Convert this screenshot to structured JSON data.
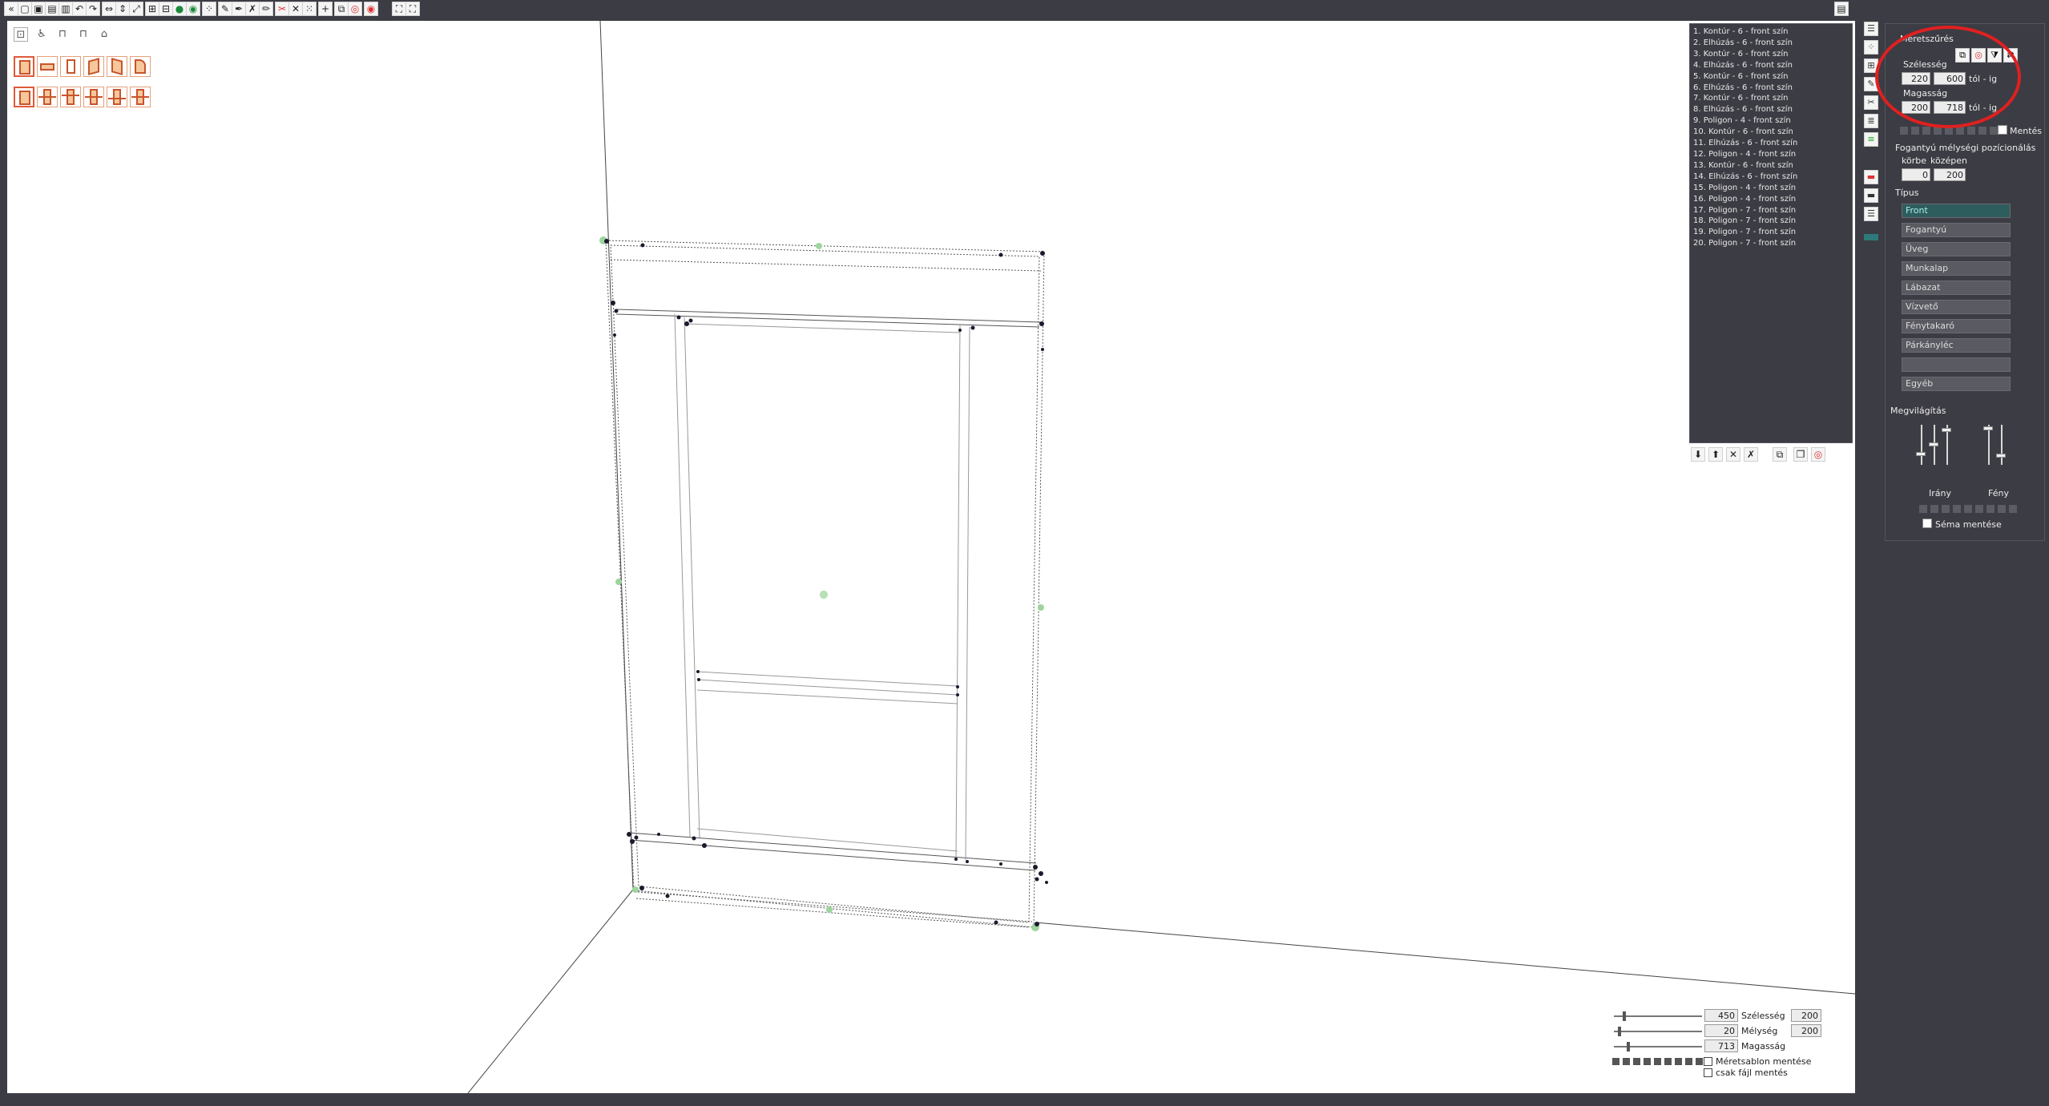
{
  "toolbar": {
    "buttons": [
      {
        "name": "back-icon",
        "glyph": "«"
      },
      {
        "name": "new-file-icon",
        "glyph": "▢"
      },
      {
        "name": "open-icon",
        "glyph": "▣"
      },
      {
        "name": "save-icon",
        "glyph": "▤"
      },
      {
        "name": "save-as-icon",
        "glyph": "▥"
      },
      {
        "name": "undo-icon",
        "glyph": "↶"
      },
      {
        "name": "redo-icon",
        "glyph": "↷"
      },
      {
        "name": "stretch-horizontal-icon",
        "glyph": "⇔"
      },
      {
        "name": "stretch-vertical-icon",
        "glyph": "⇕"
      },
      {
        "name": "stretch-diagonal-icon",
        "glyph": "⤢"
      },
      {
        "name": "snap-grid-icon",
        "glyph": "⊞"
      },
      {
        "name": "snap-edge-icon",
        "glyph": "⊟"
      },
      {
        "name": "point-add-icon",
        "glyph": "●"
      },
      {
        "name": "point-move-icon",
        "glyph": "◉"
      },
      {
        "name": "points-icon",
        "glyph": "⁘"
      },
      {
        "name": "edit-icon",
        "glyph": "✎"
      },
      {
        "name": "pen-icon",
        "glyph": "✒"
      },
      {
        "name": "cross-edit-icon",
        "glyph": "✗"
      },
      {
        "name": "brush-icon",
        "glyph": "✏"
      },
      {
        "name": "cut-icon",
        "glyph": "✂"
      },
      {
        "name": "delete-points-icon",
        "glyph": "✕"
      },
      {
        "name": "grid-points-icon",
        "glyph": "⁙"
      },
      {
        "name": "add-icon",
        "glyph": "+"
      },
      {
        "name": "copy-icon",
        "glyph": "⧉"
      },
      {
        "name": "target-icon",
        "glyph": "◎"
      },
      {
        "name": "render-icon",
        "glyph": "◉"
      },
      {
        "name": "fit-view-icon",
        "glyph": "⛶"
      },
      {
        "name": "zoom-extent-icon",
        "glyph": "⛶"
      }
    ],
    "menu_glyph": "▤"
  },
  "viewport": {
    "view_icons": [
      "door-icon",
      "chair-icon",
      "table-icon",
      "stool-icon",
      "bin-icon"
    ],
    "shape_row1": [
      "front-tall",
      "front-wide",
      "front-narrow",
      "front-skew-left",
      "front-skew-right",
      "front-corner"
    ],
    "shape_row2": [
      "split-none",
      "split-1",
      "split-2",
      "split-3",
      "split-4",
      "split-5"
    ]
  },
  "element_list": {
    "items": [
      "1. Kontúr - 6 - front szín",
      "2. Elhúzás - 6 - front szín",
      "3. Kontúr - 6 - front szín",
      "4. Elhúzás - 6 - front szín",
      "5. Kontúr - 6 - front szín",
      "6. Elhúzás - 6 - front szín",
      "7. Kontúr - 6 - front szín",
      "8. Elhúzás - 6 - front szín",
      "9. Poligon - 4 - front szín",
      "10. Kontúr - 6 - front szín",
      "11. Elhúzás - 6 - front szín",
      "12. Poligon - 4 - front szín",
      "13. Kontúr - 6 - front szín",
      "14. Elhúzás - 6 - front szín",
      "15. Poligon - 4 - front szín",
      "16. Poligon - 4 - front szín",
      "17. Poligon - 7 - front szín",
      "18. Poligon - 7 - front szín",
      "19. Poligon - 7 - front szín",
      "20. Poligon - 7 - front szín"
    ],
    "actions": [
      "move-down-icon",
      "move-up-icon",
      "delete-icon",
      "delete-all-icon",
      "layers-icon",
      "copy-icon",
      "target-icon"
    ]
  },
  "right_panel": {
    "size_filter_title": "Méretszűrés",
    "width_label": "Szélesség",
    "width_from": "220",
    "width_to": "600",
    "range_suffix": "tól - ig",
    "height_label": "Magasság",
    "height_from": "200",
    "height_to": "718",
    "save_label": "Mentés",
    "handle_title": "Fogantyú mélységi pozícionálás",
    "around_label": "körbe",
    "center_label": "középen",
    "around_value": "0",
    "center_value": "200",
    "type_title": "Típus",
    "types": [
      "Front",
      "Fogantyú",
      "Üveg",
      "Munkalap",
      "Lábazat",
      "Vízvető",
      "Fénytakaró",
      "Párkányléc",
      "",
      "Egyéb"
    ],
    "lighting_title": "Megvilágítás",
    "direction_label": "Irány",
    "light_label": "Fény",
    "save_scheme_label": "Séma mentése"
  },
  "dimensions": {
    "width_value": "450",
    "depth_value": "20",
    "height_value": "713",
    "width_label": "Szélesség",
    "depth_label": "Mélység",
    "height_label": "Magasság",
    "width_extra": "200",
    "depth_extra": "200",
    "save_template_label": "Méretsablon mentése",
    "file_only_label": "csak fájl mentés"
  },
  "colors": {
    "background": "#3c3c44",
    "viewport": "#ffffff",
    "accent": "#e05a3a",
    "annotation": "#e02020",
    "active_type": "#2e5d5d"
  }
}
